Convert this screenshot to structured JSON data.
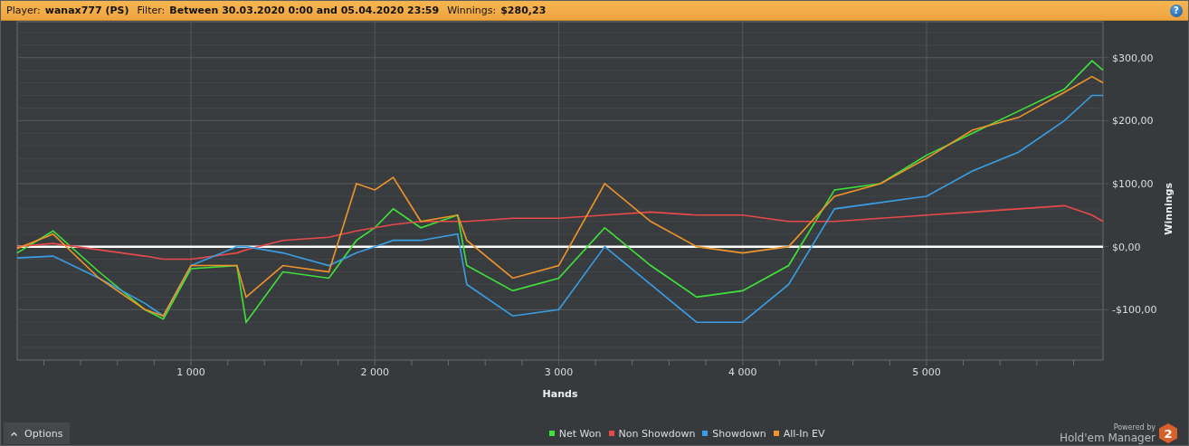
{
  "header": {
    "fields": [
      {
        "label": "Player:",
        "value": "wanax777 (PS)"
      },
      {
        "label": "Filter:",
        "value": "Between 30.03.2020 0:00 and 05.04.2020 23:59"
      },
      {
        "label": "Winnings:",
        "value": "$280,23"
      }
    ],
    "help": "?"
  },
  "chart": {
    "chart_data": {
      "type": "line",
      "xlabel": "Hands",
      "ylabel": "Winnings",
      "xlim": [
        55,
        5960
      ],
      "ylim": [
        -180,
        357
      ],
      "x": [
        55,
        250,
        500,
        750,
        850,
        1000,
        1250,
        1300,
        1500,
        1750,
        1900,
        2000,
        2100,
        2250,
        2450,
        2500,
        2750,
        3000,
        3250,
        3500,
        3750,
        4000,
        4250,
        4500,
        4750,
        5000,
        5250,
        5500,
        5750,
        5900,
        5960
      ],
      "xticks": [
        {
          "value": 1000,
          "label": "1 000"
        },
        {
          "value": 2000,
          "label": "2 000"
        },
        {
          "value": 3000,
          "label": "3 000"
        },
        {
          "value": 4000,
          "label": "4 000"
        },
        {
          "value": 5000,
          "label": "5 000"
        }
      ],
      "yticks": [
        {
          "value": -100,
          "label": "-$100,00"
        },
        {
          "value": 0,
          "label": "$0,00"
        },
        {
          "value": 100,
          "label": "$100,00"
        },
        {
          "value": 200,
          "label": "$200,00"
        },
        {
          "value": 300,
          "label": "$300,00"
        }
      ],
      "grid": true,
      "series": [
        {
          "name": "Net Won",
          "color": "#3ee43a",
          "values": [
            -10,
            25,
            -40,
            -100,
            -115,
            -35,
            -30,
            -120,
            -40,
            -50,
            10,
            30,
            60,
            30,
            50,
            -30,
            -70,
            -50,
            30,
            -30,
            -80,
            -70,
            -30,
            90,
            100,
            145,
            180,
            215,
            250,
            295,
            280
          ]
        },
        {
          "name": "Non Showdown",
          "color": "#e84a4a",
          "values": [
            0,
            5,
            -5,
            -15,
            -20,
            -20,
            -10,
            -5,
            10,
            15,
            25,
            30,
            35,
            40,
            40,
            40,
            45,
            45,
            50,
            55,
            50,
            50,
            40,
            40,
            45,
            50,
            55,
            60,
            65,
            50,
            40
          ]
        },
        {
          "name": "Showdown",
          "color": "#3a9ee4",
          "values": [
            -18,
            -15,
            -50,
            -90,
            -110,
            -30,
            0,
            0,
            -10,
            -30,
            -10,
            0,
            10,
            10,
            20,
            -60,
            -110,
            -100,
            0,
            -60,
            -120,
            -120,
            -60,
            60,
            70,
            80,
            120,
            150,
            200,
            240,
            240
          ]
        },
        {
          "name": "All-In EV",
          "color": "#f0952a",
          "values": [
            -3,
            20,
            -50,
            -100,
            -110,
            -30,
            -30,
            -80,
            -30,
            -40,
            100,
            90,
            110,
            40,
            50,
            10,
            -50,
            -30,
            100,
            40,
            0,
            -10,
            0,
            80,
            100,
            140,
            185,
            205,
            245,
            270,
            260
          ]
        }
      ]
    }
  },
  "options_button": {
    "label": "Options"
  },
  "branding": {
    "caption": "Powered by",
    "product": "Hold'em Manager",
    "badge": "2"
  }
}
